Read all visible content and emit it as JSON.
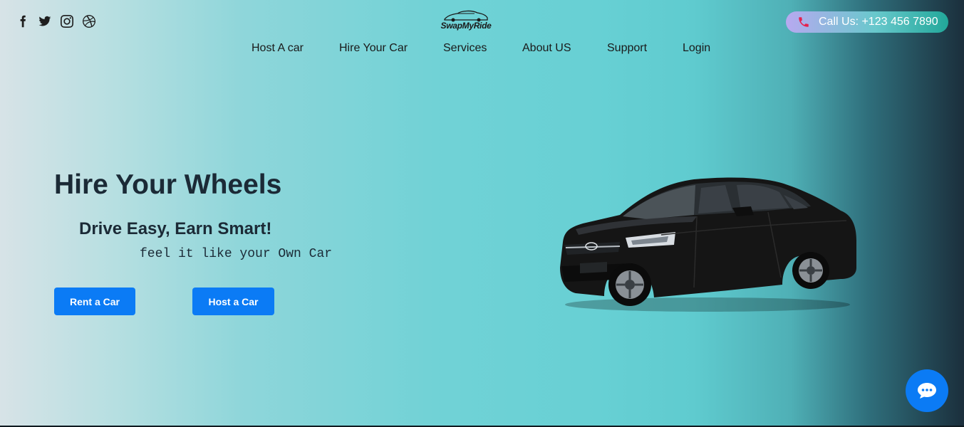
{
  "brand": {
    "logo_text": "SwapMyRide"
  },
  "social": [
    {
      "name": "facebook-icon"
    },
    {
      "name": "twitter-icon"
    },
    {
      "name": "instagram-icon"
    },
    {
      "name": "dribbble-icon"
    }
  ],
  "call": {
    "label": "Call Us: +123 456 7890",
    "gradient": [
      "#b8a9f0",
      "#22a89a"
    ]
  },
  "nav": {
    "items": [
      "Host A car",
      "Hire Your Car",
      "Services",
      "About US",
      "Support",
      "Login"
    ]
  },
  "hero": {
    "title": "Hire Your Wheels",
    "subtitle": "Drive Easy, Earn Smart!",
    "tagline": "feel it like your Own Car",
    "rent_button": "Rent a Car",
    "host_button": "Host a Car"
  },
  "colors": {
    "accent": "#0b7bf5",
    "text": "#1b2a36"
  },
  "chat": {
    "icon": "chat-bubble-icon"
  }
}
